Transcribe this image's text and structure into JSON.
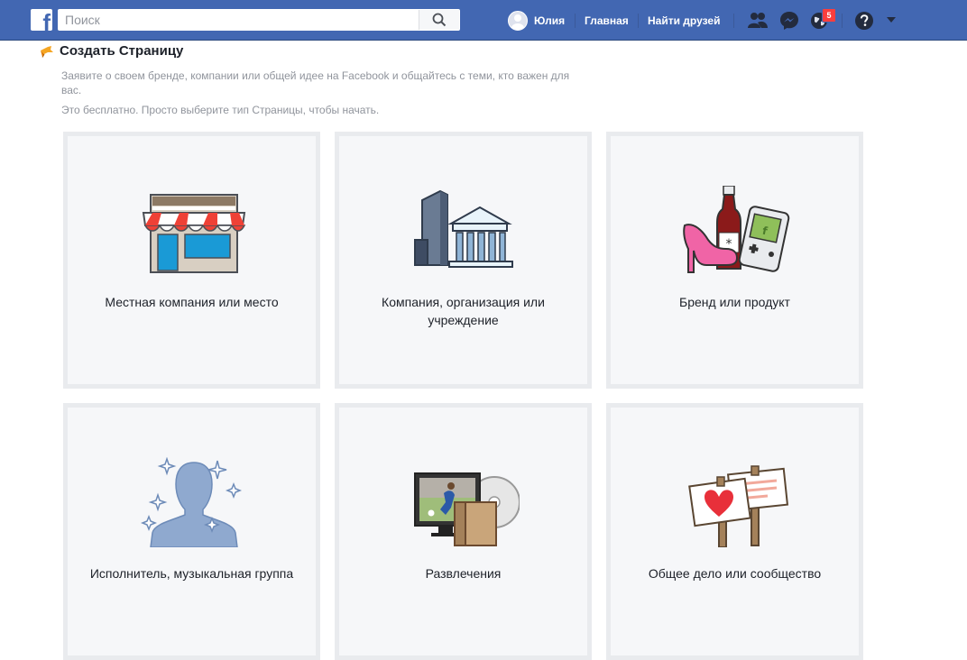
{
  "topbar": {
    "logo_letter": "f",
    "search_placeholder": "Поиск",
    "user_name": "Юлия",
    "home_label": "Главная",
    "find_friends_label": "Найти друзей",
    "notifications_count": "5",
    "brand_color": "#4267b2"
  },
  "header": {
    "title": "Создать Страницу",
    "description": "Заявите о своем бренде, компании или общей идее на Facebook и общайтесь с теми, кто важен для вас.",
    "subtitle": "Это бесплатно. Просто выберите тип Страницы, чтобы начать."
  },
  "categories": [
    {
      "label": "Местная компания или место",
      "icon": "storefront-icon"
    },
    {
      "label": "Компания, организация или учреждение",
      "icon": "company-building-icon"
    },
    {
      "label": "Бренд или продукт",
      "icon": "brand-product-icon"
    },
    {
      "label": "Исполнитель, музыкальная группа",
      "icon": "artist-silhouette-icon"
    },
    {
      "label": "Развлечения",
      "icon": "entertainment-icon"
    },
    {
      "label": "Общее дело или сообщество",
      "icon": "community-signs-icon"
    }
  ]
}
